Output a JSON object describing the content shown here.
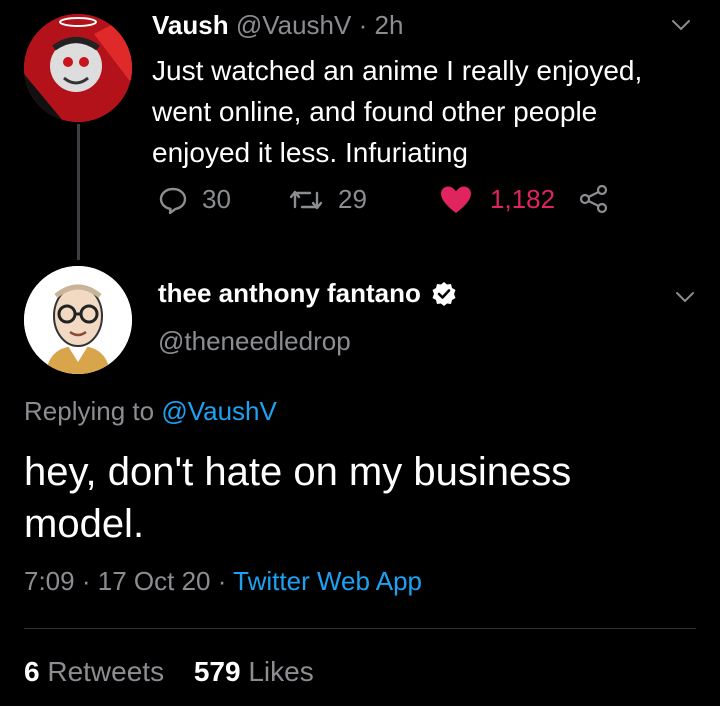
{
  "colors": {
    "background": "#000000",
    "muted": "#8b8d91",
    "accent_blue": "#1da1f2",
    "like_red": "#e0245e"
  },
  "parent_tweet": {
    "author_name": "Vaush",
    "author_handle": "@VaushV",
    "separator": "·",
    "time": "2h",
    "text": "Just watched an anime I really enjoyed, went online, and found other people enjoyed it less. Infuriating",
    "replies": "30",
    "retweets": "29",
    "likes": "1,182",
    "icons": [
      "reply-icon",
      "retweet-icon",
      "heart-icon-filled",
      "share-icon",
      "chevron-down-icon"
    ]
  },
  "focused_tweet": {
    "author_name": "thee anthony fantano",
    "author_handle": "@theneedledrop",
    "verified": true,
    "replying_prefix": "Replying to",
    "replying_to": "@VaushV",
    "text": "hey, don't hate on my business model.",
    "time": "7:09",
    "date": "17 Oct 20",
    "source": "Twitter Web App",
    "retweets_count": "6",
    "retweets_label": "Retweets",
    "likes_count": "579",
    "likes_label": "Likes"
  }
}
